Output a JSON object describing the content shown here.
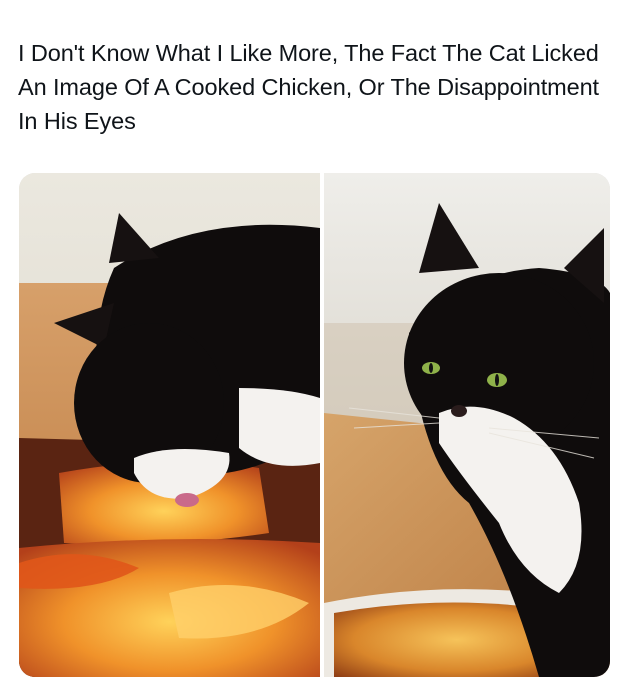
{
  "post": {
    "caption": "I Don't Know What I Like More, The Fact The Cat Licked An Image Of A Cooked Chicken, Or The Disappointment In His Eyes"
  },
  "colors": {
    "cat_fur": "#0f0c0c",
    "cat_white": "#f4f2ef",
    "table_wood": "#c8894a",
    "wall": "#e8e4da",
    "food_orange": "#e8781e",
    "eye_green": "#8fb24a"
  }
}
